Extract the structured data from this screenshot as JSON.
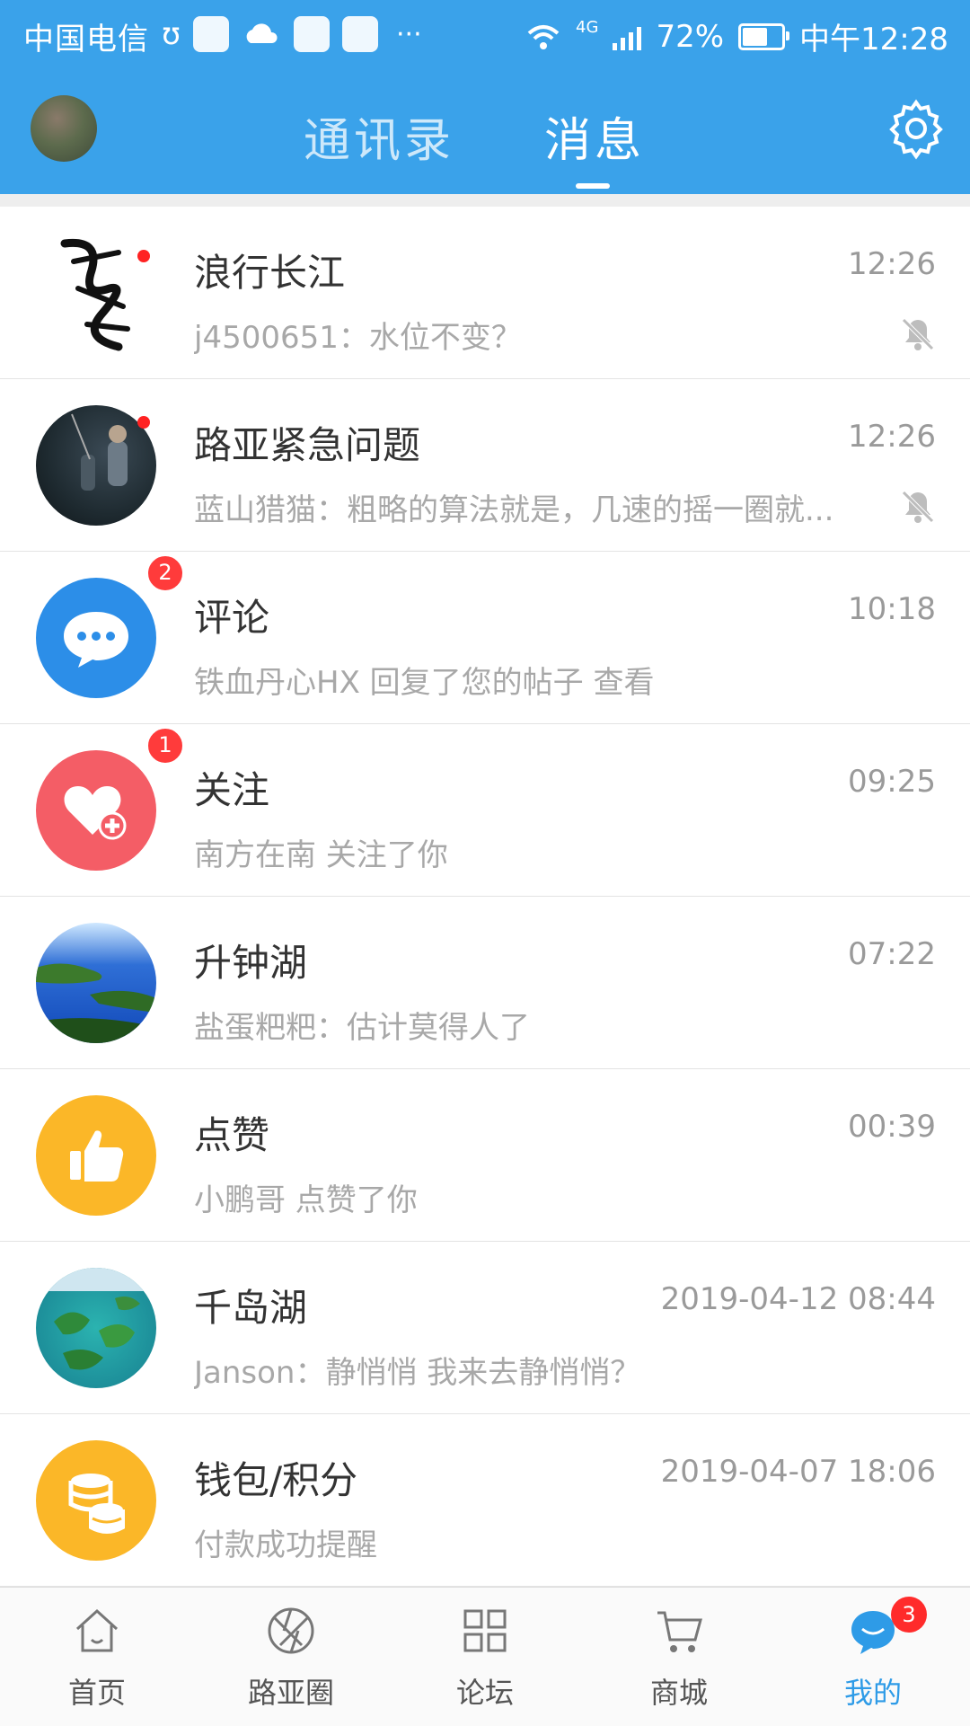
{
  "status_bar": {
    "carrier": "中国电信",
    "more": "···",
    "network": "4G",
    "battery_percent": "72%",
    "battery_level": 0.72,
    "clock": "中午12:28"
  },
  "header": {
    "tabs": [
      "通讯录",
      "消息"
    ],
    "active_tab": "消息"
  },
  "messages": [
    {
      "title": "浪行长江",
      "time": "12:26",
      "preview": "j4500651：水位不变？",
      "muted": true,
      "unread_dot": true
    },
    {
      "title": "路亚紧急问题",
      "time": "12:26",
      "preview": "蓝山猎猫：粗略的算法就是，几速的摇一圈就...",
      "muted": true,
      "unread_dot": true
    },
    {
      "title": "评论",
      "time": "10:18",
      "preview": "铁血丹心HX 回复了您的帖子   查看",
      "badge": "2"
    },
    {
      "title": "关注",
      "time": "09:25",
      "preview": "南方在南 关注了你",
      "badge": "1"
    },
    {
      "title": "升钟湖",
      "time": "07:22",
      "preview": "盐蛋粑粑：估计莫得人了"
    },
    {
      "title": "点赞",
      "time": "00:39",
      "preview": "小鹏哥 点赞了你"
    },
    {
      "title": "千岛湖",
      "time": "2019-04-12 08:44",
      "preview": "Janson：静悄悄 我来去静悄悄？"
    },
    {
      "title": "钱包/积分",
      "time": "2019-04-07 18:06",
      "preview": "付款成功提醒"
    }
  ],
  "tabbar": {
    "items": [
      {
        "label": "首页",
        "icon": "home-icon"
      },
      {
        "label": "路亚圈",
        "icon": "aperture-icon"
      },
      {
        "label": "论坛",
        "icon": "grid-icon"
      },
      {
        "label": "商城",
        "icon": "cart-icon"
      },
      {
        "label": "我的",
        "icon": "chat-bubble-icon",
        "badge": "3",
        "active": true
      }
    ]
  },
  "colors": {
    "primary": "#3aa2ea",
    "active_tab": "#2e9be7",
    "badge": "#ff3b3b",
    "comment_icon_bg": "#2c8ee8",
    "follow_icon_bg": "#f45d66",
    "like_icon_bg": "#fbb728",
    "wallet_icon_bg": "#fbb728"
  }
}
